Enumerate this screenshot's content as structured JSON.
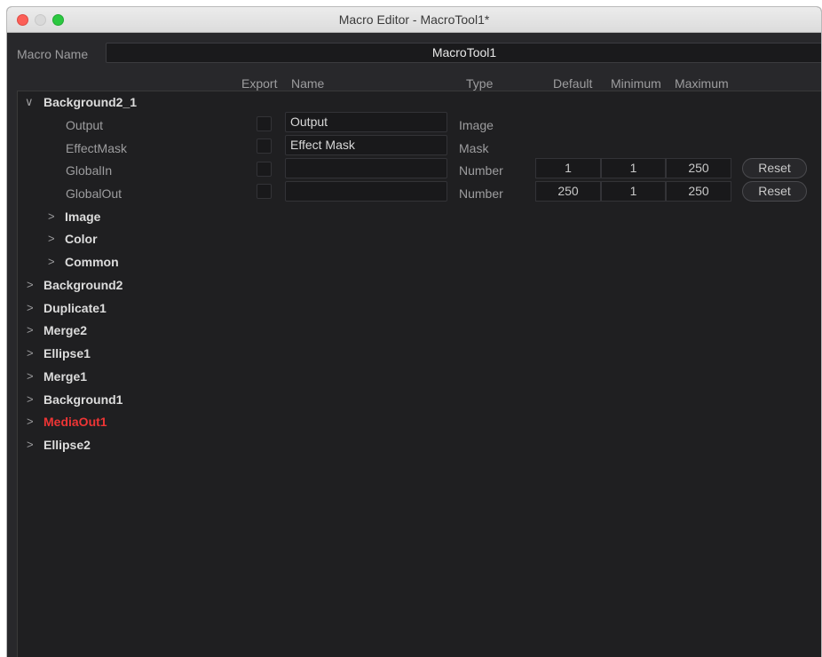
{
  "window": {
    "title": "Macro Editor - MacroTool1*"
  },
  "macro": {
    "label": "Macro Name",
    "value": "MacroTool1"
  },
  "columns": {
    "export": "Export",
    "name": "Name",
    "type": "Type",
    "default": "Default",
    "minimum": "Minimum",
    "maximum": "Maximum"
  },
  "tree": {
    "root": {
      "label": "Background2_1",
      "chevron": "∨"
    },
    "params": [
      {
        "label": "Output",
        "name_value": "Output",
        "type": "Image"
      },
      {
        "label": "EffectMask",
        "name_value": "Effect Mask",
        "type": "Mask"
      },
      {
        "label": "GlobalIn",
        "name_value": "",
        "type": "Number",
        "default": "1",
        "minimum": "1",
        "maximum": "250",
        "reset": "Reset"
      },
      {
        "label": "GlobalOut",
        "name_value": "",
        "type": "Number",
        "default": "250",
        "minimum": "1",
        "maximum": "250",
        "reset": "Reset"
      }
    ],
    "groups": [
      {
        "label": "Image",
        "chevron": ">"
      },
      {
        "label": "Color",
        "chevron": ">"
      },
      {
        "label": "Common",
        "chevron": ">"
      }
    ],
    "nodes": [
      {
        "label": "Background2",
        "chevron": ">"
      },
      {
        "label": "Duplicate1",
        "chevron": ">"
      },
      {
        "label": "Merge2",
        "chevron": ">"
      },
      {
        "label": "Ellipse1",
        "chevron": ">"
      },
      {
        "label": "Merge1",
        "chevron": ">"
      },
      {
        "label": "Background1",
        "chevron": ">"
      },
      {
        "label": "MediaOut1",
        "chevron": ">",
        "color": "#ee3535"
      },
      {
        "label": "Ellipse2",
        "chevron": ">"
      }
    ]
  },
  "colors": {
    "accent_red": "#ee3535",
    "panel": "#1f1f21",
    "window": "#28282b"
  }
}
